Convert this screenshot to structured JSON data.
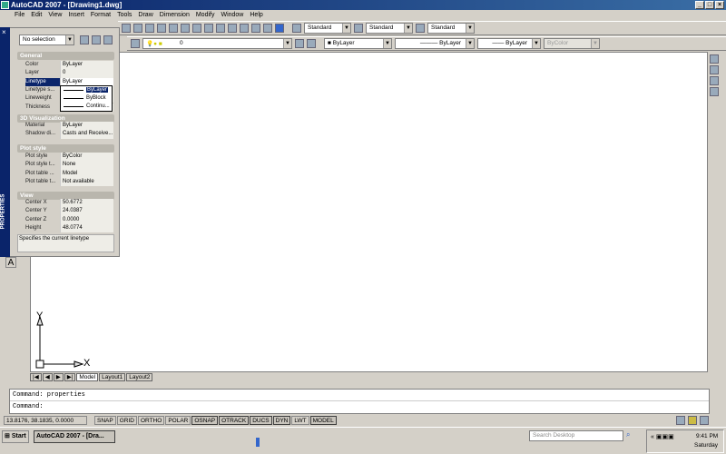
{
  "window": {
    "title": "AutoCAD 2007 - [Drawing1.dwg]"
  },
  "menu": [
    "File",
    "Edit",
    "View",
    "Insert",
    "Format",
    "Tools",
    "Draw",
    "Dimension",
    "Modify",
    "Window",
    "Help"
  ],
  "styles": {
    "text_style": "Standard",
    "dim_style": "Standard",
    "table_style": "Standard"
  },
  "layers": {
    "current_layer": "0"
  },
  "props_toolbar": {
    "color": "ByLayer",
    "linetype": "ByLayer",
    "lineweight": "ByLayer",
    "plotstyle": "ByColor"
  },
  "palette": {
    "selection": "No selection",
    "side_label": "PROPERTIES",
    "sections": {
      "general": "General",
      "viz": "3D Visualization",
      "plot": "Plot style",
      "view": "View"
    },
    "general": [
      {
        "k": "Color",
        "v": "ByLayer"
      },
      {
        "k": "Layer",
        "v": "0"
      },
      {
        "k": "Linetype",
        "v": "ByLayer"
      },
      {
        "k": "Linetype s...",
        "v": ""
      },
      {
        "k": "Lineweight",
        "v": ""
      },
      {
        "k": "Thickness",
        "v": ""
      }
    ],
    "viz": [
      {
        "k": "Material",
        "v": "ByLayer"
      },
      {
        "k": "Shadow di...",
        "v": "Casts and Receive..."
      }
    ],
    "plot": [
      {
        "k": "Plot style",
        "v": "ByColor"
      },
      {
        "k": "Plot style t...",
        "v": "None"
      },
      {
        "k": "Plot table ...",
        "v": "Model"
      },
      {
        "k": "Plot table t...",
        "v": "Not available"
      }
    ],
    "view": [
      {
        "k": "Center X",
        "v": "50.6772"
      },
      {
        "k": "Center Y",
        "v": "24.0387"
      },
      {
        "k": "Center Z",
        "v": "0.0000"
      },
      {
        "k": "Height",
        "v": "48.0774"
      }
    ],
    "dropdown": [
      "ByLayer",
      "ByBlock",
      "Continu..."
    ],
    "description": "Specifies the current linetype"
  },
  "ucs": {
    "x": "X",
    "y": "Y"
  },
  "tabs": [
    "Model",
    "Layout1",
    "Layout2"
  ],
  "command": {
    "history": "Command: properties",
    "prompt": "Command:"
  },
  "status": {
    "coords": "13.8176, 38.1835, 0.0000",
    "toggles": [
      "SNAP",
      "GRID",
      "ORTHO",
      "POLAR",
      "OSNAP",
      "OTRACK",
      "DUCS",
      "DYN",
      "LWT",
      "MODEL"
    ]
  },
  "taskbar": {
    "start": "Start",
    "task": "AutoCAD 2007 - [Dra...",
    "search_placeholder": "Search Desktop",
    "time": "9:41 PM",
    "day": "Saturday"
  },
  "left_tool": "A"
}
